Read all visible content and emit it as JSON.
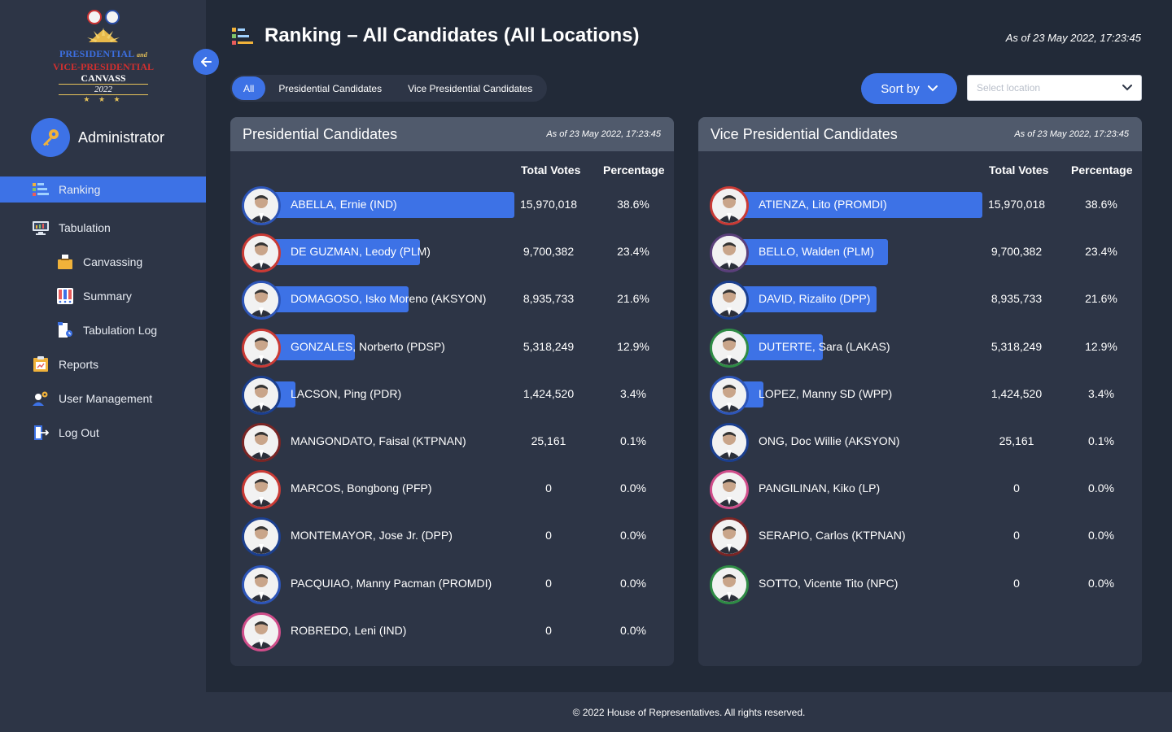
{
  "logo": {
    "line1": "PRESIDENTIAL",
    "line1_and": "and",
    "line2": "VICE-PRESIDENTIAL",
    "line3": "CANVASS",
    "year": "2022",
    "stars": "★ ★ ★"
  },
  "user": {
    "name": "Administrator"
  },
  "nav": [
    {
      "label": "Ranking",
      "icon": "ranking-icon",
      "active": true,
      "level": 1
    },
    {
      "label": "Tabulation",
      "icon": "monitor-icon",
      "level": 1
    },
    {
      "label": "Canvassing",
      "icon": "ballot-box-icon",
      "level": 2
    },
    {
      "label": "Summary",
      "icon": "summary-icon",
      "level": 2
    },
    {
      "label": "Tabulation Log",
      "icon": "log-icon",
      "level": 2
    },
    {
      "label": "Reports",
      "icon": "reports-icon",
      "level": 1
    },
    {
      "label": "User Management",
      "icon": "users-icon",
      "level": 1
    },
    {
      "label": "Log Out",
      "icon": "logout-icon",
      "level": 1
    }
  ],
  "header": {
    "title": "Ranking – All Candidates (All Locations)",
    "timestamp": "As of 23 May 2022, 17:23:45"
  },
  "tabs": [
    "All",
    "Presidential Candidates",
    "Vice Presidential Candidates"
  ],
  "sort": {
    "label": "Sort by"
  },
  "location": {
    "placeholder": "Select location"
  },
  "colors": {
    "accent": "#3d72e6",
    "panel": "#2d3546",
    "panel_head": "#505a6c",
    "background": "#222a38"
  },
  "presidential": {
    "title": "Presidential Candidates",
    "timestamp": "As of 23 May 2022, 17:23:45",
    "col_votes": "Total Votes",
    "col_pct": "Percentage",
    "candidates": [
      {
        "name": "ABELLA, Ernie (IND)",
        "votes": "15,970,018",
        "pct": "38.6%",
        "share": 38.6,
        "ring": "blue"
      },
      {
        "name": "DE GUZMAN, Leody (PLM)",
        "votes": "9,700,382",
        "pct": "23.4%",
        "share": 23.4,
        "ring": "red"
      },
      {
        "name": "DOMAGOSO, Isko Moreno (AKSYON)",
        "votes": "8,935,733",
        "pct": "21.6%",
        "share": 21.6,
        "ring": "blue"
      },
      {
        "name": "GONZALES, Norberto (PDSP)",
        "votes": "5,318,249",
        "pct": "12.9%",
        "share": 12.9,
        "ring": "red"
      },
      {
        "name": "LACSON, Ping (PDR)",
        "votes": "1,424,520",
        "pct": "3.4%",
        "share": 3.4,
        "ring": "navy"
      },
      {
        "name": "MANGONDATO, Faisal (KTPNAN)",
        "votes": "25,161",
        "pct": "0.1%",
        "share": 0.1,
        "ring": "maroon"
      },
      {
        "name": "MARCOS, Bongbong (PFP)",
        "votes": "0",
        "pct": "0.0%",
        "share": 0,
        "ring": "red"
      },
      {
        "name": "MONTEMAYOR, Jose Jr. (DPP)",
        "votes": "0",
        "pct": "0.0%",
        "share": 0,
        "ring": "navy"
      },
      {
        "name": "PACQUIAO, Manny Pacman (PROMDI)",
        "votes": "0",
        "pct": "0.0%",
        "share": 0,
        "ring": "blue"
      },
      {
        "name": "ROBREDO, Leni (IND)",
        "votes": "0",
        "pct": "0.0%",
        "share": 0,
        "ring": "pink"
      }
    ]
  },
  "vice_presidential": {
    "title": "Vice Presidential Candidates",
    "timestamp": "As of 23 May 2022, 17:23:45",
    "col_votes": "Total Votes",
    "col_pct": "Percentage",
    "candidates": [
      {
        "name": "ATIENZA, Lito (PROMDI)",
        "votes": "15,970,018",
        "pct": "38.6%",
        "share": 38.6,
        "ring": "red"
      },
      {
        "name": "BELLO, Walden (PLM)",
        "votes": "9,700,382",
        "pct": "23.4%",
        "share": 23.4,
        "ring": "purple"
      },
      {
        "name": "DAVID, Rizalito (DPP)",
        "votes": "8,935,733",
        "pct": "21.6%",
        "share": 21.6,
        "ring": "navy"
      },
      {
        "name": "DUTERTE, Sara (LAKAS)",
        "votes": "5,318,249",
        "pct": "12.9%",
        "share": 12.9,
        "ring": "green"
      },
      {
        "name": "LOPEZ, Manny SD (WPP)",
        "votes": "1,424,520",
        "pct": "3.4%",
        "share": 3.4,
        "ring": "blue"
      },
      {
        "name": "ONG, Doc Willie (AKSYON)",
        "votes": "25,161",
        "pct": "0.1%",
        "share": 0.1,
        "ring": "navy"
      },
      {
        "name": "PANGILINAN, Kiko (LP)",
        "votes": "0",
        "pct": "0.0%",
        "share": 0,
        "ring": "pink"
      },
      {
        "name": "SERAPIO, Carlos (KTPNAN)",
        "votes": "0",
        "pct": "0.0%",
        "share": 0,
        "ring": "maroon"
      },
      {
        "name": "SOTTO, Vicente Tito (NPC)",
        "votes": "0",
        "pct": "0.0%",
        "share": 0,
        "ring": "green"
      }
    ]
  },
  "footer": "© 2022 House of Representatives. All rights reserved."
}
